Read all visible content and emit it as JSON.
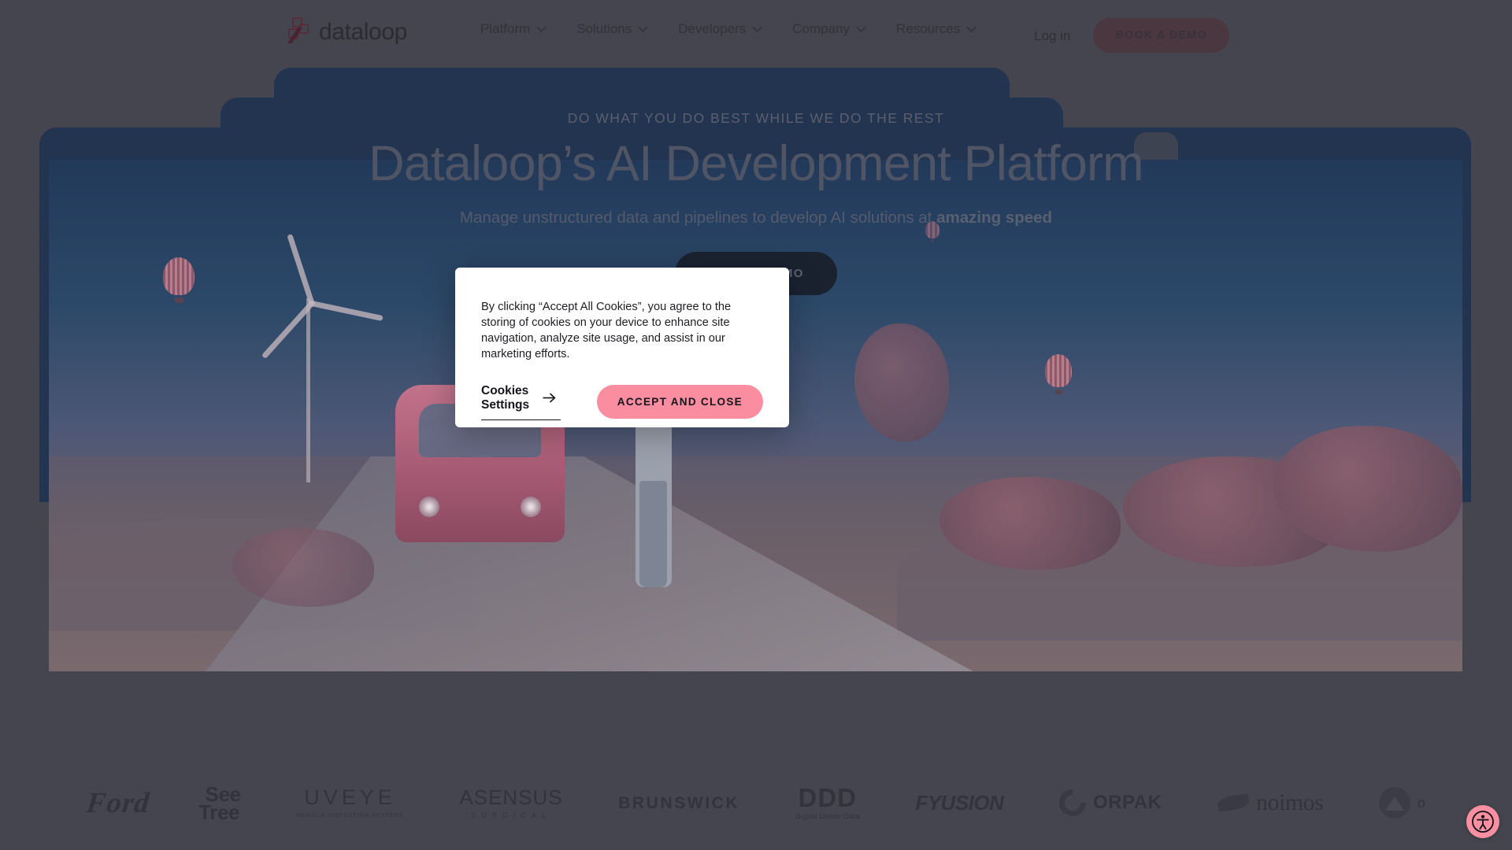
{
  "header": {
    "logo_text": "dataloop",
    "logo_icon": "dataloop-blocks-icon",
    "nav": [
      {
        "label": "Platform",
        "icon": "chevron-down-icon"
      },
      {
        "label": "Solutions",
        "icon": "chevron-down-icon"
      },
      {
        "label": "Developers",
        "icon": "chevron-down-icon"
      },
      {
        "label": "Company",
        "icon": "chevron-down-icon"
      },
      {
        "label": "Resources",
        "icon": "chevron-down-icon"
      }
    ],
    "login_label": "Log in",
    "demo_button_label": "BOOK A DEMO"
  },
  "hero": {
    "eyebrow": "DO WHAT YOU DO BEST WHILE WE DO THE REST",
    "headline": "Dataloop’s AI Development Platform",
    "subhead_prefix": "Manage  unstructured data and pipelines to develop AI solutions at ",
    "subhead_emphasis": "amazing speed",
    "cta_label": "BOOK A DEMO"
  },
  "clients": {
    "ford": "Ford",
    "seetree_line1": "See",
    "seetree_line2": "Tree",
    "uveye_main": "UVEYE",
    "uveye_sub": "VEHICLE INSPECTION SYSTEMS",
    "asensus_main": "ASENSUS",
    "asensus_sub": "SURGICAL",
    "brunswick": "BRUNSWICK",
    "ddd_main": "DDD",
    "ddd_sub": "Digital Divide Data",
    "fyusion": "FYUSION",
    "orpak": "ORPAK",
    "noimos": "noimos",
    "last": "o"
  },
  "cookie_modal": {
    "body": "By clicking “Accept All Cookies”, you agree to the storing of cookies on your device to enhance site navigation, analyze site usage, and assist in our marketing efforts.",
    "settings_label": "Cookies Settings",
    "settings_icon": "arrow-right-icon",
    "accept_label": "ACCEPT AND CLOSE"
  },
  "accessibility": {
    "icon": "accessibility-person-icon",
    "color": "#f990a2"
  },
  "colors": {
    "page_background": "#45454f",
    "hero_frame": "#223450",
    "accent_pink": "#fa8d9f",
    "modal_background": "#ffffff",
    "header_button": "#4b3740"
  }
}
